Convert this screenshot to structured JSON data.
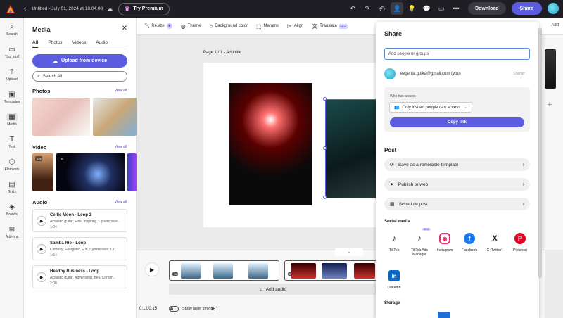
{
  "topbar": {
    "doc_title": "Untitled - July 01, 2024 at 10.04.08",
    "premium_label": "Try Premium",
    "download_label": "Download",
    "share_label": "Share"
  },
  "leftnav": {
    "items": [
      {
        "label": "Search",
        "icon": "search-icon"
      },
      {
        "label": "Your stuff",
        "icon": "folder-icon"
      },
      {
        "label": "Upload",
        "icon": "upload-icon"
      },
      {
        "label": "Templates",
        "icon": "templates-icon"
      },
      {
        "label": "Media",
        "icon": "media-icon"
      },
      {
        "label": "Text",
        "icon": "text-icon"
      },
      {
        "label": "Elements",
        "icon": "elements-icon"
      },
      {
        "label": "Grids",
        "icon": "grids-icon"
      },
      {
        "label": "Brands",
        "icon": "brands-icon"
      },
      {
        "label": "Add-ons",
        "icon": "addons-icon"
      }
    ]
  },
  "media_panel": {
    "title": "Media",
    "tabs": [
      "All",
      "Photos",
      "Videos",
      "Audio"
    ],
    "upload_label": "Upload from device",
    "search_placeholder": "Search All",
    "photos_title": "Photos",
    "video_title": "Video",
    "audio_title": "Audio",
    "view_all": "View all",
    "video_badges": [
      "14s",
      "6s"
    ],
    "audio": [
      {
        "title": "Celtic Moon - Loop 2",
        "desc": "Acoustic guitar, Folk, Inspiring, Cyberspace...",
        "duration": "1:04"
      },
      {
        "title": "Samba Rio - Loop",
        "desc": "Comedy, Energetic, Fun, Cyberspace, La...",
        "duration": "1:54"
      },
      {
        "title": "Healthy Business - Loop",
        "desc": "Acoustic guitar, Advertising, Bell, Corpor...",
        "duration": "2:08"
      }
    ]
  },
  "toolbar": {
    "resize": "Resize",
    "theme": "Theme",
    "background": "Background color",
    "margins": "Margins",
    "align": "Align",
    "translate": "Translate",
    "new_tag": "NEW",
    "add": "Add"
  },
  "canvas": {
    "page_label": "Page 1 / 1 - Add title"
  },
  "timeline": {
    "frame_badge": "5s",
    "add_audio": "Add audio",
    "time": "0:12/0:15",
    "layer_timing": "Show layer timing"
  },
  "share": {
    "title": "Share",
    "input_placeholder": "Add people or groups",
    "user_email": "evgenia.gulka@gmail.com (you)",
    "owner_label": "Owner",
    "who_access_label": "Who has access",
    "access_value": "Only invited people can access",
    "copy_link": "Copy link",
    "post_title": "Post",
    "post_rows": [
      "Save as a remixable template",
      "Publish to web",
      "Schedule post"
    ],
    "social_title": "Social media",
    "social": [
      {
        "label": "TikTok",
        "icon": "tiktok-icon"
      },
      {
        "label": "TikTok Ads Manager",
        "icon": "tiktok-ads-icon",
        "tag": "NEW"
      },
      {
        "label": "Instagram",
        "icon": "instagram-icon"
      },
      {
        "label": "Facebook",
        "icon": "facebook-icon"
      },
      {
        "label": "X (Twitter)",
        "icon": "x-icon"
      },
      {
        "label": "Pinterest",
        "icon": "pinterest-icon"
      },
      {
        "label": "LinkedIn",
        "icon": "linkedin-icon"
      }
    ],
    "storage_title": "Storage"
  },
  "colors": {
    "accent": "#5c5ce0",
    "topbar": "#1e1e24"
  }
}
